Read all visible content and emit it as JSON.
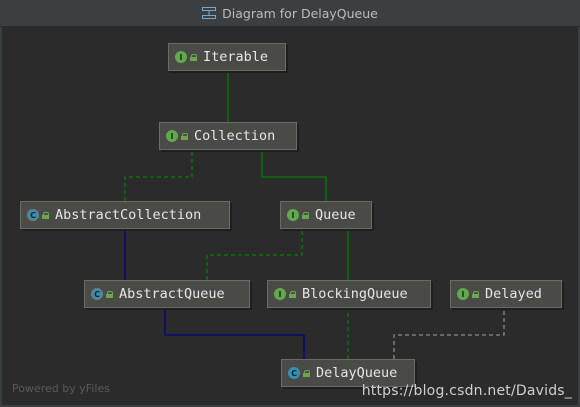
{
  "window": {
    "title": "Diagram for DelayQueue",
    "title_icon": "diagram-icon"
  },
  "colors": {
    "background": "#2b2b2b",
    "node_fill": "#4a4a46",
    "extends_class": "#00008b",
    "extends_interface": "#008000",
    "implements": "#008000",
    "realization_gray": "#8a8a8a",
    "interface_badge": "#62a84d",
    "class_badge": "#3a8fb0"
  },
  "nodes": [
    {
      "id": "Iterable",
      "label": "Iterable",
      "kind": "interface",
      "badge": "I"
    },
    {
      "id": "Collection",
      "label": "Collection",
      "kind": "interface",
      "badge": "I"
    },
    {
      "id": "AbstractCollection",
      "label": "AbstractCollection",
      "kind": "abstract-class",
      "badge": "C"
    },
    {
      "id": "Queue",
      "label": "Queue",
      "kind": "interface",
      "badge": "I"
    },
    {
      "id": "AbstractQueue",
      "label": "AbstractQueue",
      "kind": "abstract-class",
      "badge": "C"
    },
    {
      "id": "BlockingQueue",
      "label": "BlockingQueue",
      "kind": "interface",
      "badge": "I"
    },
    {
      "id": "Delayed",
      "label": "Delayed",
      "kind": "interface",
      "badge": "I"
    },
    {
      "id": "DelayQueue",
      "label": "DelayQueue",
      "kind": "class",
      "badge": "C"
    }
  ],
  "edges": [
    {
      "from": "Collection",
      "to": "Iterable",
      "type": "extends-interface"
    },
    {
      "from": "AbstractCollection",
      "to": "Collection",
      "type": "implements"
    },
    {
      "from": "Queue",
      "to": "Collection",
      "type": "extends-interface"
    },
    {
      "from": "AbstractQueue",
      "to": "AbstractCollection",
      "type": "extends-class"
    },
    {
      "from": "AbstractQueue",
      "to": "Queue",
      "type": "implements"
    },
    {
      "from": "BlockingQueue",
      "to": "Queue",
      "type": "extends-interface"
    },
    {
      "from": "DelayQueue",
      "to": "AbstractQueue",
      "type": "extends-class"
    },
    {
      "from": "DelayQueue",
      "to": "BlockingQueue",
      "type": "implements"
    },
    {
      "from": "DelayQueue",
      "to": "Delayed",
      "type": "implements-gray"
    }
  ],
  "footer": {
    "powered_by": "Powered by yFiles"
  },
  "watermark": "https://blog.csdn.net/Davids_"
}
